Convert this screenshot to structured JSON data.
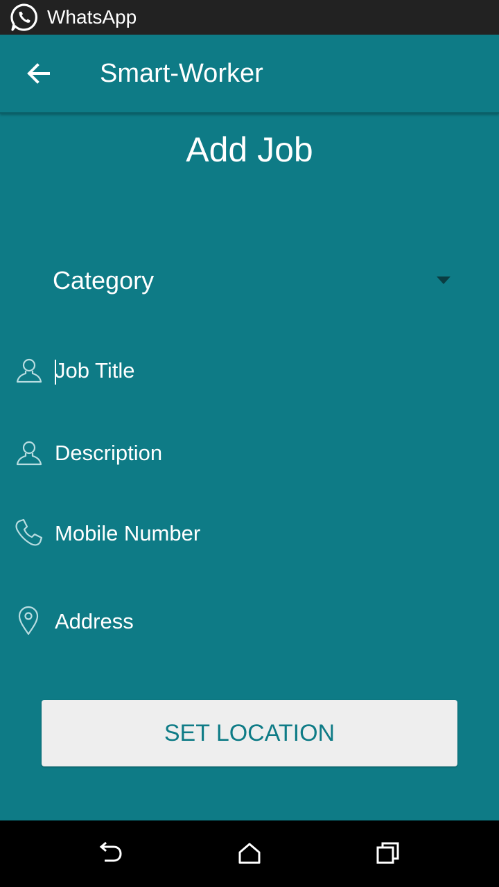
{
  "status_bar": {
    "notification_icon": "whatsapp-icon",
    "notification_label": "WhatsApp"
  },
  "app_bar": {
    "back_icon": "arrow-back-icon",
    "title": "Smart-Worker"
  },
  "page": {
    "title": "Add Job"
  },
  "form": {
    "category": {
      "label": "Category",
      "icon": "dropdown-arrow-icon"
    },
    "fields": [
      {
        "placeholder": "Job Title",
        "icon": "person-outline-icon",
        "focused": true
      },
      {
        "placeholder": "Description",
        "icon": "person-outline-icon"
      },
      {
        "placeholder": "Mobile Number",
        "icon": "phone-icon"
      },
      {
        "placeholder": "Address",
        "icon": "location-pin-icon"
      }
    ]
  },
  "set_location_button": {
    "label": "SET LOCATION"
  },
  "nav_bar": {
    "back_icon": "nav-back-icon",
    "home_icon": "nav-home-icon",
    "recents_icon": "nav-recents-icon"
  },
  "colors": {
    "primary": "#0e7b86",
    "status_bar": "#222222",
    "nav_bar": "#000000",
    "button_bg": "#eeeeee",
    "text_on_primary": "#ffffff"
  }
}
